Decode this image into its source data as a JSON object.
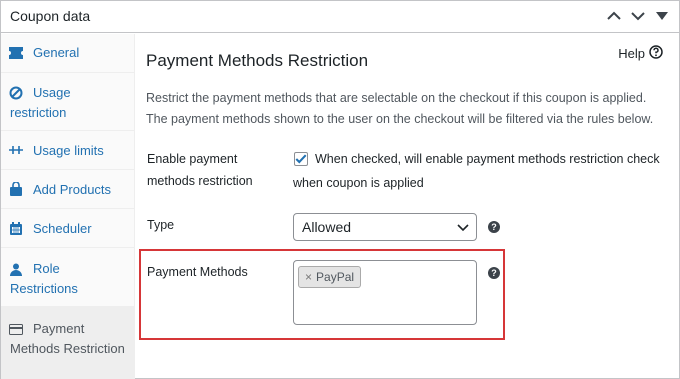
{
  "header": {
    "title": "Coupon data",
    "controls": [
      "chevron-up-icon",
      "chevron-down-icon",
      "collapse-triangle-icon"
    ]
  },
  "sidebar": {
    "items": [
      {
        "label": "General",
        "icon": "ticket-icon",
        "active": false
      },
      {
        "label": "Usage restriction",
        "icon": "block-icon",
        "active": false
      },
      {
        "label": "Usage limits",
        "icon": "limits-icon",
        "active": false
      },
      {
        "label": "Add Products",
        "icon": "cart-icon",
        "active": false
      },
      {
        "label": "Scheduler",
        "icon": "calendar-icon",
        "active": false
      },
      {
        "label": "Role Restrictions",
        "icon": "person-icon",
        "active": false
      },
      {
        "label": "Payment Methods Restriction",
        "icon": "card-icon",
        "active": true
      }
    ]
  },
  "main": {
    "heading": "Payment Methods Restriction",
    "help_label": "Help",
    "description": "Restrict the payment methods that are selectable on the checkout if this coupon is applied. The payment methods shown to the user on the checkout will be filtered via the rules below.",
    "enable": {
      "label": "Enable payment methods restriction",
      "checked": true,
      "text": "When checked, will enable payment methods restriction check when coupon is applied"
    },
    "type": {
      "label": "Type",
      "value": "Allowed"
    },
    "payment_methods": {
      "label": "Payment Methods",
      "selected": [
        {
          "remove": "×",
          "name": "PayPal"
        }
      ]
    }
  },
  "colors": {
    "link": "#2271b1",
    "highlight_border": "#d63638",
    "checkbox_check": "#2271b1"
  }
}
